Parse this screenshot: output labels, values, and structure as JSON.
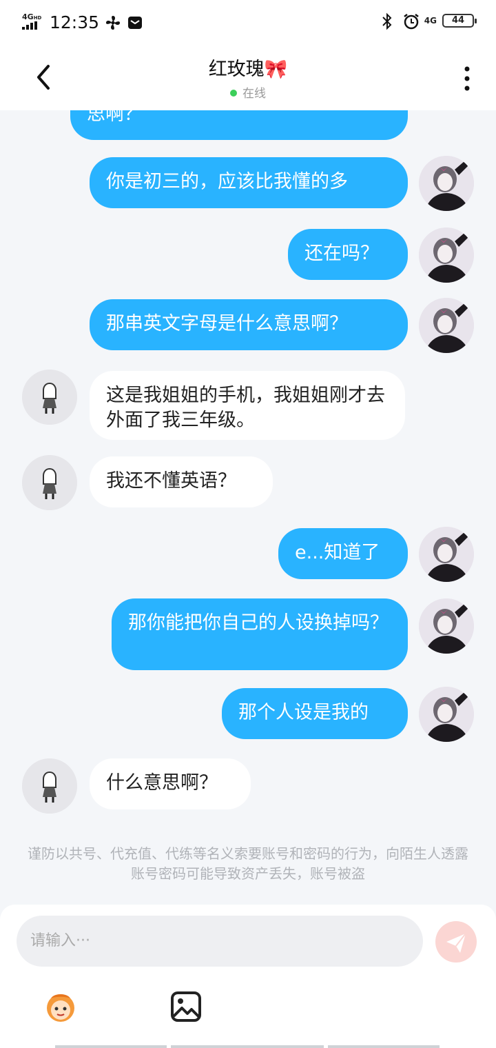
{
  "status_bar": {
    "network": "4G",
    "network_sup": "HD",
    "time": "12:35",
    "right_network": "4G",
    "battery": "44"
  },
  "header": {
    "title": "红玫瑰🎀",
    "status": "在线"
  },
  "messages": [
    {
      "side": "out",
      "text": "思啊？"
    },
    {
      "side": "out",
      "text": "你是初三的，应该比我懂的多"
    },
    {
      "side": "out",
      "text": "还在吗？"
    },
    {
      "side": "out",
      "text": "那串英文字母是什么意思啊？"
    },
    {
      "side": "in",
      "text": "这是我姐姐的手机，我姐姐刚才去外面了我三年级。"
    },
    {
      "side": "in",
      "text": "我还不懂英语？"
    },
    {
      "side": "out",
      "text": "e...知道了"
    },
    {
      "side": "out",
      "text": "那你能把你自己的人设换掉吗？"
    },
    {
      "side": "out",
      "text": "那个人设是我的"
    },
    {
      "side": "in",
      "text": "什么意思啊？"
    }
  ],
  "notice": "谨防以共号、代充值、代练等名义索要账号和密码的行为，向陌生人透露账号密码可能导致资产丢失，账号被盗",
  "input": {
    "placeholder": "请输入···"
  },
  "icons": {
    "back": "chevron-left-icon",
    "more": "more-vertical-icon",
    "send": "send-icon",
    "emoji": "emoji-sticker-icon",
    "image": "image-icon"
  },
  "colors": {
    "outgoing_bubble": "#29b3ff",
    "incoming_bubble": "#ffffff",
    "online_dot": "#3ccf5a",
    "send_button": "#fbd6d3",
    "background": "#f4f6f9"
  }
}
